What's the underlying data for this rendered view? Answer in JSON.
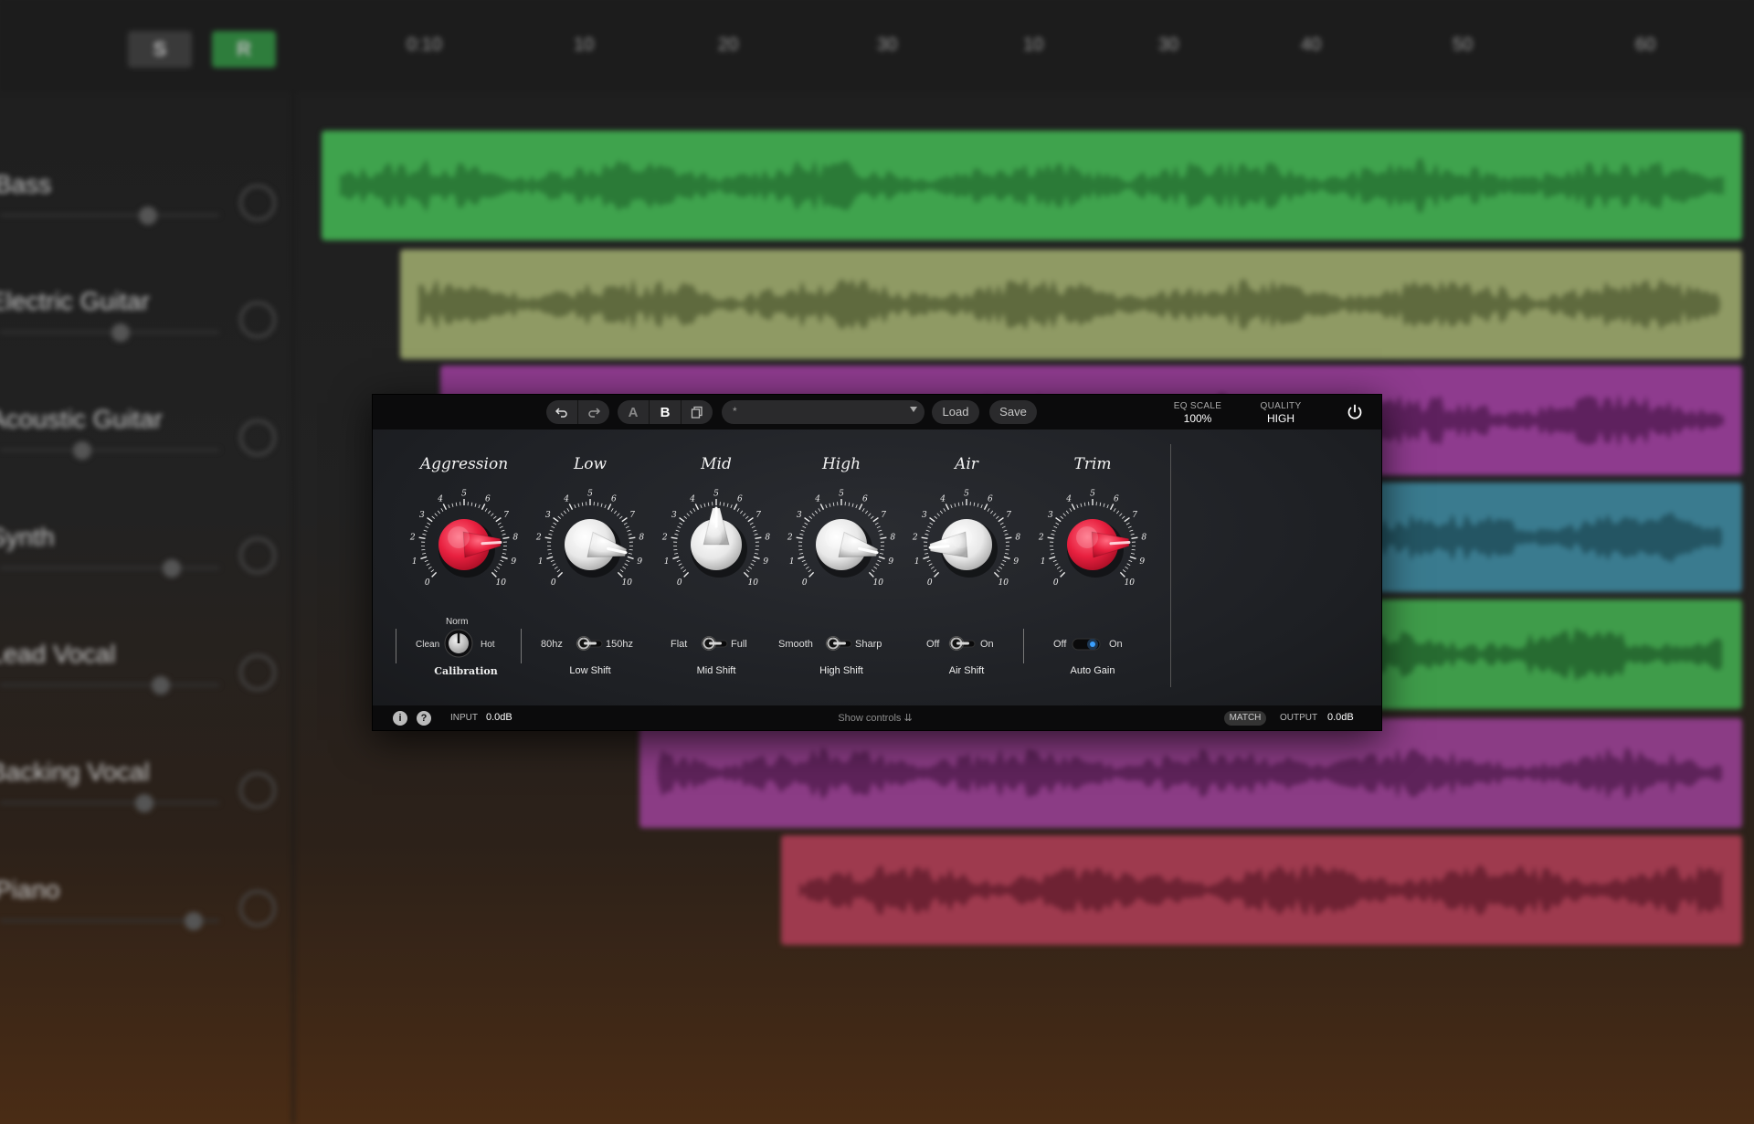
{
  "daw": {
    "header_buttons": [
      {
        "label": "S",
        "color": "#3a3a3a"
      },
      {
        "label": "R",
        "color": "#2e7d3c"
      }
    ],
    "ruler": [
      "0:10",
      "10",
      "20",
      "30",
      "10",
      "30",
      "40",
      "50",
      "60"
    ],
    "tracks": [
      {
        "name": "Bass",
        "color": "#3fa34d",
        "wave": "#2b7a37"
      },
      {
        "name": "Electric Guitar",
        "color": "#8f9a64",
        "wave": "#5f6a3e"
      },
      {
        "name": "Acoustic Guitar",
        "color": "#8e3b8e",
        "wave": "#5e215e"
      },
      {
        "name": "Synth",
        "color": "#3a7b8f",
        "wave": "#245563"
      },
      {
        "name": "Lead Vocal",
        "color": "#3f9c4a",
        "wave": "#276b31"
      },
      {
        "name": "Backing Vocal",
        "color": "#8b3c85",
        "wave": "#5e235a"
      },
      {
        "name": "Piano",
        "color": "#9e3a4e",
        "wave": "#6e2233"
      }
    ]
  },
  "plugin": {
    "toolbar": {
      "undo_icon": "undo-icon",
      "redo_icon": "redo-icon",
      "a_label": "A",
      "b_label": "B",
      "copy_icon": "copy-icon",
      "preset_value": "*",
      "load_label": "Load",
      "save_label": "Save",
      "eq_scale_label": "EQ SCALE",
      "eq_scale_value": "100%",
      "quality_label": "QUALITY",
      "quality_value": "HIGH",
      "power_icon": "power-icon"
    },
    "knobs": [
      {
        "title": "Aggression",
        "style": "red",
        "value": 8.2
      },
      {
        "title": "Low",
        "style": "white",
        "value": 8.8
      },
      {
        "title": "Mid",
        "style": "white",
        "value": 5.0
      },
      {
        "title": "High",
        "style": "white",
        "value": 8.8
      },
      {
        "title": "Air",
        "style": "white",
        "value": 1.5
      },
      {
        "title": "Trim",
        "style": "red",
        "value": 8.2
      }
    ],
    "dial_numbers": [
      "0",
      "1",
      "2",
      "3",
      "4",
      "5",
      "6",
      "7",
      "8",
      "9",
      "10"
    ],
    "controls": {
      "calibration": {
        "top": "Norm",
        "left": "Clean",
        "right": "Hot",
        "name": "Calibration"
      },
      "low_shift": {
        "left": "80hz",
        "right": "150hz",
        "name": "Low Shift"
      },
      "mid_shift": {
        "left": "Flat",
        "right": "Full",
        "name": "Mid Shift"
      },
      "high_shift": {
        "left": "Smooth",
        "right": "Sharp",
        "name": "High Shift"
      },
      "air_shift": {
        "left": "Off",
        "right": "On",
        "name": "Air Shift"
      },
      "auto_gain": {
        "left": "Off",
        "right": "On",
        "name": "Auto Gain",
        "state": "On"
      }
    },
    "bottom": {
      "info_icon": "info-icon",
      "help_icon": "help-icon",
      "input_label": "INPUT",
      "input_value": "0.0dB",
      "show_controls": "Show controls",
      "match_label": "MATCH",
      "output_label": "OUTPUT",
      "output_value": "0.0dB"
    },
    "accent_red": "#e8203f",
    "accent_blue": "#3aa0ff"
  }
}
